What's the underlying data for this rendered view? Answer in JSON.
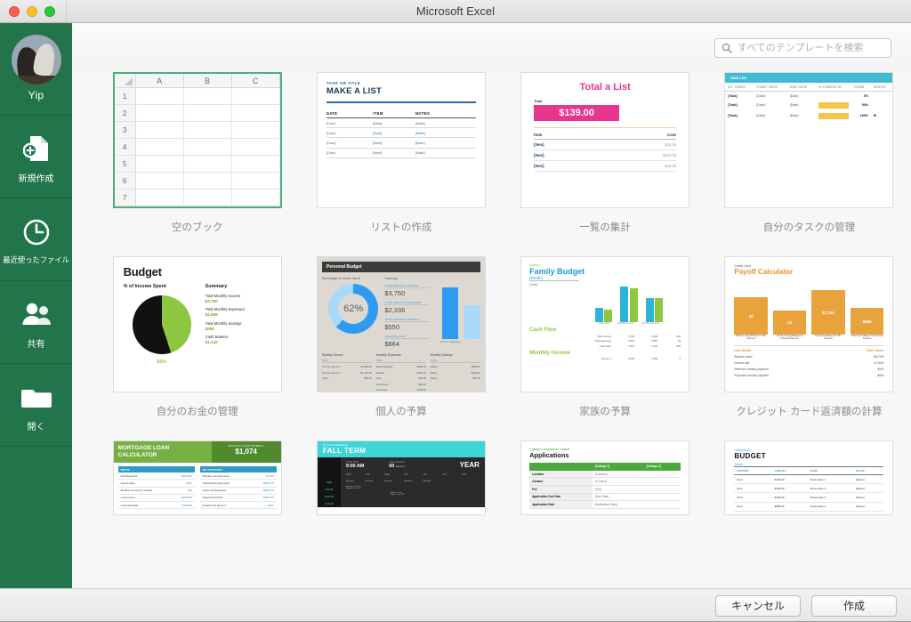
{
  "window": {
    "title": "Microsoft Excel",
    "traffic_lights": [
      "close",
      "minimize",
      "zoom"
    ]
  },
  "sidebar": {
    "accent_color": "#22744a",
    "user": {
      "name": "Yip",
      "avatar_alt": "horses"
    },
    "items": [
      {
        "label": "新規作成",
        "icon": "new-document-icon"
      },
      {
        "label": "最近使ったファイル",
        "icon": "clock-icon"
      },
      {
        "label": "共有",
        "icon": "people-icon"
      },
      {
        "label": "開く",
        "icon": "folder-icon"
      }
    ]
  },
  "search": {
    "placeholder": "すべてのテンプレートを検索",
    "value": "",
    "icon": "search-icon"
  },
  "templates": [
    {
      "label": "空のブック",
      "selected": true,
      "preview": {
        "kind": "blank-workbook",
        "columns": [
          "A",
          "B",
          "C"
        ],
        "rows": [
          "1",
          "2",
          "3",
          "4",
          "5",
          "6",
          "7"
        ]
      }
    },
    {
      "label": "リストの作成",
      "selected": false,
      "preview": {
        "kind": "make-a-list",
        "kicker": "TASK OR TITLE",
        "title": "MAKE A LIST",
        "headers": [
          "DATE",
          "ITEM",
          "NOTES"
        ],
        "rows": [
          [
            "[Date]",
            "[Item]",
            "[Note]"
          ],
          [
            "[Date]",
            "[Item]",
            "[Note]"
          ],
          [
            "[Date]",
            "[Item]",
            "[Note]"
          ],
          [
            "[Date]",
            "[Item]",
            "[Note]"
          ]
        ],
        "accent": "#2e6ca4"
      }
    },
    {
      "label": "一覧の集計",
      "selected": false,
      "preview": {
        "kind": "total-a-list",
        "title": "Total a List",
        "total_label": "Total",
        "total_value": "$139.00",
        "headers": [
          "Item",
          "Cost"
        ],
        "rows": [
          [
            "[Item]",
            "$22.00"
          ],
          [
            "[Item]",
            "$102.00"
          ],
          [
            "[Item]",
            "$15.00"
          ]
        ],
        "accent": "#e8368f"
      }
    },
    {
      "label": "自分のタスクの管理",
      "selected": false,
      "preview": {
        "kind": "task-list",
        "title": "Task List",
        "headers": [
          "MY TASKS",
          "START DATE",
          "DUE DATE",
          "% COMPLETE",
          "DONE",
          "NOTES"
        ],
        "rows": [
          {
            "task": "[Task]",
            "start": "[Date]",
            "due": "[Date]",
            "pct": "0%",
            "bar": 0,
            "done": false
          },
          {
            "task": "[Task]",
            "start": "[Date]",
            "due": "[Date]",
            "pct": "50%",
            "bar": 50,
            "done": false
          },
          {
            "task": "[Task]",
            "start": "[Date]",
            "due": "[Date]",
            "pct": "100%",
            "bar": 100,
            "done": true
          }
        ],
        "accent": "#3fbcd4"
      }
    },
    {
      "label": "自分のお金の管理",
      "selected": false,
      "preview": {
        "kind": "my-money-budget",
        "title": "Budget",
        "pie_title": "% of Income Spent",
        "pie_pct": "55%",
        "pie_value": 55,
        "summary_title": "Summary",
        "summary": [
          {
            "label": "Total Monthly Income",
            "value": "$3,750"
          },
          {
            "label": "Total Monthly Expenses",
            "value": "$2,058"
          },
          {
            "label": "Total Monthly Savings",
            "value": "$550"
          },
          {
            "label": "Cash Balance",
            "value": "$1,142"
          }
        ],
        "accent": "#8dc63f"
      }
    },
    {
      "label": "個人の予算",
      "selected": false,
      "preview": {
        "kind": "personal-budget",
        "title": "Personal Budget",
        "donut_caption": "Percentage of Income Spent",
        "donut_pct": "62%",
        "donut_value": 62,
        "summary_title": "Summary",
        "summary": [
          {
            "label": "TOTAL MONTHLY INCOME",
            "value": "$3,750"
          },
          {
            "label": "TOTAL MONTHLY EXPENSES",
            "value": "$2,336"
          },
          {
            "label": "TOTAL MONTHLY SAVINGS",
            "value": "$550"
          },
          {
            "label": "CASH BALANCE",
            "value": "$864"
          }
        ],
        "bar_legend": [
          "Income",
          "Expenses"
        ],
        "tables": [
          {
            "title": "Monthly Income",
            "headers": [
              "ITEM",
              "AMOUNT"
            ],
            "rows": [
              [
                "Income Source 1",
                "$2,500.00"
              ],
              [
                "Income Source 2",
                "$1,200.00"
              ],
              [
                "Other",
                "$50.00"
              ]
            ]
          },
          {
            "title": "Monthly Expenses",
            "headers": [
              "ITEM",
              "DUE DATE",
              "AMOUNT"
            ],
            "rows": [
              [
                "Rent/mortgage",
                "[Date]",
                "$800.00"
              ],
              [
                "Electric",
                "[Date]",
                "$120.00"
              ],
              [
                "Gas",
                "[Date]",
                "$85.00"
              ],
              [
                "Cell phone",
                "[Date]",
                "$45.00"
              ],
              [
                "Groceries",
                "[Date]",
                "$400.00"
              ]
            ]
          },
          {
            "title": "Monthly Savings",
            "headers": [
              "DATE",
              "AMOUNT"
            ],
            "rows": [
              [
                "[Date]",
                "$250.00"
              ],
              [
                "[Date]",
                "$250.00"
              ],
              [
                "[Date]",
                "$50.00"
              ]
            ]
          }
        ],
        "accent": "#2e9bf0"
      }
    },
    {
      "label": "家族の予算",
      "selected": false,
      "preview": {
        "kind": "family-budget",
        "name_placeholder": "[Name]",
        "title": "Family Budget",
        "month_placeholder": "[Month]",
        "year_placeholder": "[Year]",
        "legend": [
          "Projected",
          "Actual"
        ],
        "chart_categories": [
          "Cash Flow",
          "Monthly Income",
          "Monthly Expense"
        ],
        "sections": [
          {
            "title": "Cash Flow",
            "headers": [
              "Projected",
              "Actual",
              "Variance"
            ],
            "rows": [
              [
                "Total Income",
                "5,700",
                "5,500",
                "-200"
              ],
              [
                "Total Expenses",
                "3,803",
                "3,855",
                "-52"
              ],
              [
                "Total Cash",
                "1,897",
                "1,645",
                "-252"
              ]
            ]
          },
          {
            "title": "Monthly Income",
            "headers": [
              "Projected",
              "Actual",
              "Variance"
            ],
            "rows": [
              [
                "Income 1",
                "4,000",
                "4,000",
                "0"
              ]
            ]
          }
        ],
        "accent": "#1c9ad6"
      }
    },
    {
      "label": "クレジット カード返済額の計算",
      "selected": false,
      "preview": {
        "kind": "credit-card-payoff",
        "kicker": "Credit Card",
        "title": "Payoff Calculator",
        "boxes": [
          {
            "value": "40",
            "caption": "Months To Payoff Based On Min. Payment"
          },
          {
            "value": "22",
            "caption": "Months To Payoff Based On Proposed Payment"
          },
          {
            "value": "$1,784",
            "caption": "Total Interest Based On Min. Payment"
          },
          {
            "value": "$865",
            "caption": "Total Interest Based On Proposed Payment"
          }
        ],
        "table_title": "Loan Details",
        "table_value_header": "Enter Values",
        "rows": [
          [
            "Balance owed",
            "$10,000"
          ],
          [
            "Interest rate",
            "12.50%"
          ],
          [
            "Minimum monthly payment",
            "$300"
          ],
          [
            "Proposed monthly payment",
            "$500"
          ]
        ],
        "accent": "#e8912a"
      }
    },
    {
      "label": "",
      "selected": false,
      "preview": {
        "kind": "mortgage-loan",
        "title_line1": "MORTGAGE LOAN",
        "title_line2": "CALCULATOR",
        "badge_label": "MONTHLY LOAN PAYMENT",
        "badge_value": "$1,074",
        "left_header": "INPUTS",
        "left_rows": [
          [
            "Purchase Price",
            "$200,000"
          ],
          [
            "Interest Rate",
            "5.0%"
          ],
          [
            "Duration of Loan (in months)",
            "360"
          ],
          [
            "Loan Amount",
            "$200,000"
          ],
          [
            "Loan Start Date",
            "1/1/2015"
          ]
        ],
        "right_header": "KEY STATISTICS",
        "right_rows": [
          [
            "Monthly Loan Payments",
            "$1,074"
          ],
          [
            "Total Monthly Payments*",
            "$520,679"
          ],
          [
            "Total Loan Payments",
            "$386,679"
          ],
          [
            "Total Interest Paid",
            "$186,679"
          ],
          [
            "Property Tax Amount",
            "$371"
          ]
        ],
        "accent": "#76b043"
      }
    },
    {
      "label": "",
      "selected": false,
      "preview": {
        "kind": "class-schedule",
        "kicker": "MY CLASS SCHEDULE",
        "title": "FALL TERM",
        "year_label": "YEAR",
        "start_label": "START TIME",
        "start_value": "9:00 AM",
        "interval_label": "TIME INTERVAL",
        "interval_value": "60",
        "interval_unit": "(Minutes)",
        "time_col": "TIME",
        "days": [
          "MON",
          "TUE",
          "WED",
          "THU",
          "FRI",
          "SAT",
          "SUN"
        ],
        "times": [
          "9:00 AM",
          "10:00 AM",
          "11:00 AM"
        ],
        "cells": [
          "[Section]",
          "[Section]",
          "[Section]",
          "[Section]",
          "[Section]"
        ],
        "notes": [
          "Science - Lecture",
          "Bldg A / Rm 101",
          "Physics - Lab",
          "Bldg L / Rm 140"
        ],
        "accent": "#3fd3da"
      }
    },
    {
      "label": "",
      "selected": false,
      "preview": {
        "kind": "college-tracker",
        "kicker": "College Comparison Tracker",
        "title": "Applications",
        "headers": [
          "",
          "[College 1]",
          "[College 2]"
        ],
        "rows": [
          [
            "Location",
            "[Location]",
            ""
          ],
          [
            "Contact",
            "[Contact]",
            ""
          ],
          [
            "Fee",
            "[Fee]",
            ""
          ],
          [
            "Application Due Date",
            "[Due Date]",
            ""
          ],
          [
            "Application Date",
            "[Application Date]",
            ""
          ]
        ],
        "accent": "#4aa83c"
      }
    },
    {
      "label": "",
      "selected": false,
      "preview": {
        "kind": "household-budget",
        "kicker": "Household",
        "title": "BUDGET",
        "section": "Detail",
        "headers": [
          "EXPENSE",
          "AMOUNT",
          "NAME",
          "NOTES"
        ],
        "rows": [
          [
            "Rent",
            "$300.00",
            "Roommate 1",
            "[Notes]"
          ],
          [
            "Rent",
            "$250.00",
            "Roommate 2",
            "[Notes]"
          ],
          [
            "Rent",
            "$200.00",
            "Roommate 3",
            "[Notes]"
          ],
          [
            "Rent",
            "$350.00",
            "Roommate 4",
            "[Notes]"
          ]
        ],
        "accent": "#3e9ed4"
      }
    }
  ],
  "footer": {
    "cancel_label": "キャンセル",
    "create_label": "作成"
  }
}
